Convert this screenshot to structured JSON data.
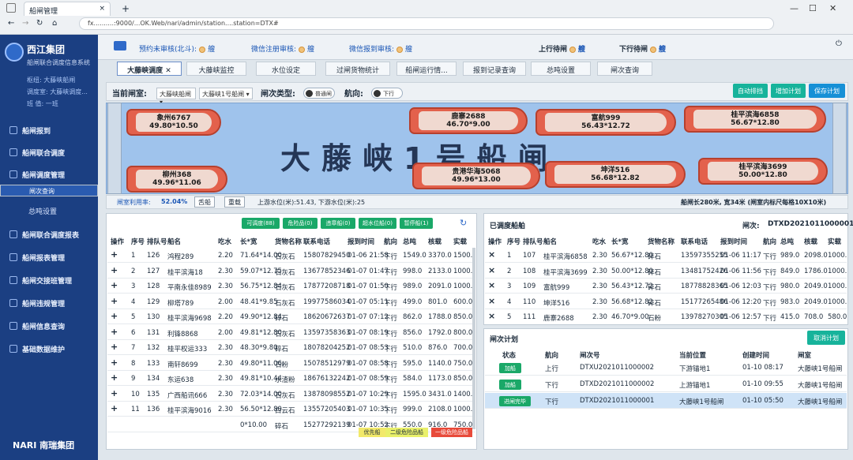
{
  "browser": {
    "tab_title": "船闸管理",
    "address": "fx..........:9000/...OK.Web/nari/admin/station....station=DTX#",
    "new_tab": "+",
    "close_tab": "×"
  },
  "sidebar": {
    "brand": "西江集团",
    "subtitle": "船闸联合调度信息系统",
    "user1": "枢纽: 大藤峡船闸",
    "user2": "调度室: 大藤峡调度...",
    "user3": "班 值: 一班",
    "items": [
      {
        "label": "船闸报到"
      },
      {
        "label": "船闸联合调度"
      },
      {
        "label": "船闸调度管理"
      },
      {
        "label": "闸次查询"
      },
      {
        "label": "总吨设置"
      },
      {
        "label": "船闸联合调度报表"
      },
      {
        "label": "船闸报表管理"
      },
      {
        "label": "船闸交接班管理"
      },
      {
        "label": "船闸违规管理"
      },
      {
        "label": "船闸信息查询"
      },
      {
        "label": "基础数据维护"
      }
    ],
    "footer": "NARI 南瑞集团"
  },
  "statusbar": {
    "s1": "预约未审核(北斗):",
    "v1": "艘",
    "s2": "微信注册审核:",
    "v2": "艘",
    "s3": "微信报到审核:",
    "v3": "艘",
    "s4": "上行待闸",
    "v4": "艘",
    "s5": "下行待闸",
    "v5": "艘"
  },
  "tabs": [
    "大藤峡调度",
    "大藤峡监控",
    "水位设定",
    "过闸货物统计",
    "船闸运行情...",
    "报到记录查询",
    "总吨设置",
    "闸次查询"
  ],
  "toolbar": {
    "lock_label": "当前闸室:",
    "lock_sel1": "大藤峡船闸",
    "lock_sel2": "大藤峡1号船闸",
    "type_label": "闸次类型:",
    "type_val": "普通闸",
    "dir_label": "航向:",
    "dir_val": "下行",
    "btn_auto": "自动排挡",
    "btn_add": "增加计划",
    "btn_save": "保存计划"
  },
  "lock": {
    "title": "大藤峡1号船闸",
    "ships": [
      {
        "name": "象州6767",
        "dim": "49.80*10.50"
      },
      {
        "name": "鹿寨2688",
        "dim": "46.70*9.00"
      },
      {
        "name": "富航999",
        "dim": "56.43*12.72"
      },
      {
        "name": "桂平滨海6858",
        "dim": "56.67*12.80"
      },
      {
        "name": "柳州368",
        "dim": "49.96*11.06"
      },
      {
        "name": "贵港华海5068",
        "dim": "49.96*13.00"
      },
      {
        "name": "坤洋516",
        "dim": "56.68*12.82"
      },
      {
        "name": "桂平滨海3699",
        "dim": "50.00*12.80"
      }
    ]
  },
  "infobar": {
    "util_label": "闸室利用率:",
    "util_val": "52.04%",
    "btn_cut": "舌船",
    "btn_rev": "重载",
    "water": "上游水位(米):51.43,  下游水位(米):25",
    "size": "船闸长280米, 宽34米 (闸室内标尺每格10X10米)"
  },
  "left": {
    "chips": [
      "可调度(88)",
      "危险品(0)",
      "违章船(0)",
      "超水位船(0)",
      "暂停船(1)"
    ],
    "headers": [
      "操作",
      "序号",
      "排队号",
      "船名",
      "吃水",
      "长*宽",
      "货物名称",
      "联系电话",
      "报到时间",
      "航向",
      "总吨",
      "核载",
      "实载"
    ],
    "rows": [
      [
        "+",
        "1",
        "126",
        "鸿程289",
        "2.20",
        "71.64*14.00",
        "石灰石",
        "15807829450",
        "01-06 21:58",
        "下行",
        "1549.0",
        "3370.0",
        "1500.0"
      ],
      [
        "+",
        "2",
        "127",
        "桂平滨海18",
        "2.30",
        "59.07*12.75",
        "石灰石",
        "13677852346",
        "01-07 01:47",
        "下行",
        "998.0",
        "2133.0",
        "1000.0"
      ],
      [
        "+",
        "3",
        "128",
        "平南永佳8989",
        "2.30",
        "56.75*12.84",
        "石灰石",
        "17877208718",
        "01-07 01:50",
        "下行",
        "989.0",
        "2091.0",
        "1000.0"
      ],
      [
        "+",
        "4",
        "129",
        "柳塔789",
        "2.00",
        "48.41*9.85",
        "石灰石",
        "19977586034",
        "01-07 05:11",
        "下行",
        "499.0",
        "801.0",
        "600.0"
      ],
      [
        "+",
        "5",
        "130",
        "桂平滨海9698",
        "2.20",
        "49.90*12.84",
        "碎石",
        "18620672637",
        "01-07 07:12",
        "下行",
        "862.0",
        "1788.0",
        "850.0"
      ],
      [
        "+",
        "6",
        "131",
        "利锋8868",
        "2.00",
        "49.81*12.80",
        "石灰石",
        "13597358363",
        "01-07 08:19",
        "下行",
        "856.0",
        "1792.0",
        "800.0"
      ],
      [
        "+",
        "7",
        "132",
        "桂平权运333",
        "2.30",
        "48.30*9.80",
        "碎石",
        "18078204252",
        "01-07 08:53",
        "下行",
        "510.0",
        "876.0",
        "700.0"
      ],
      [
        "+",
        "8",
        "133",
        "南轩8699",
        "2.30",
        "49.80*11.06",
        "石粉",
        "15078512979",
        "01-07 08:58",
        "下行",
        "595.0",
        "1140.0",
        "750.0"
      ],
      [
        "+",
        "9",
        "134",
        "东运638",
        "2.30",
        "49.81*10.44",
        "水渣粉",
        "18676132242",
        "01-07 08:59",
        "下行",
        "584.0",
        "1173.0",
        "850.0"
      ],
      [
        "+",
        "10",
        "135",
        "广西船讯666",
        "2.30",
        "72.03*14.00",
        "石灰石",
        "13878098552",
        "01-07 10:29",
        "下行",
        "1595.0",
        "3431.0",
        "1400.0"
      ],
      [
        "+",
        "11",
        "136",
        "桂平滨海9016",
        "2.30",
        "56.50*12.80",
        "白云石",
        "13557205403",
        "01-07 10:35",
        "下行",
        "999.0",
        "2108.0",
        "1000.0"
      ],
      [
        "",
        "",
        "",
        "",
        "",
        "0*10.00",
        "碎石",
        "15277292139",
        "01-07 10:52",
        "下行",
        "550.0",
        "916.0",
        "750.0"
      ]
    ],
    "legend": [
      "优先船",
      "二级危险品船",
      "一级危险品船"
    ]
  },
  "right": {
    "title": "已调度船舶",
    "lockno_label": "闸次:",
    "lockno": "DTXD2021011000001",
    "headers": [
      "操作",
      "序号",
      "排队号",
      "船名",
      "吃水",
      "长*宽",
      "货物名称",
      "联系电话",
      "报到时间",
      "航向",
      "总吨",
      "核载",
      "实载"
    ],
    "rows": [
      [
        "×",
        "1",
        "107",
        "桂平滨海6858",
        "2.30",
        "56.67*12.80",
        "碎石",
        "13597355255",
        "01-06 11:17",
        "下行",
        "989.0",
        "2098.0",
        "1000.0"
      ],
      [
        "×",
        "2",
        "108",
        "桂平滨海3699",
        "2.30",
        "50.00*12.80",
        "碎石",
        "13481752426",
        "01-06 11:56",
        "下行",
        "849.0",
        "1786.0",
        "1000.0"
      ],
      [
        "×",
        "3",
        "109",
        "富航999",
        "2.30",
        "56.43*12.72",
        "碎石",
        "18778828365",
        "01-06 12:03",
        "下行",
        "980.0",
        "2049.0",
        "1000.0"
      ],
      [
        "×",
        "4",
        "110",
        "坤洋516",
        "2.30",
        "56.68*12.82",
        "碎石",
        "15177265486",
        "01-06 12:20",
        "下行",
        "983.0",
        "2049.0",
        "1000.0"
      ],
      [
        "×",
        "5",
        "111",
        "鹿寨2688",
        "2.30",
        "46.70*9.00",
        "石粉",
        "13978270305",
        "01-06 12:57",
        "下行",
        "415.0",
        "708.0",
        "580.0"
      ]
    ],
    "plan_title": "闸次计划",
    "plan_cancel": "取消计划",
    "plan_headers": [
      "状态",
      "航向",
      "闸次号",
      "当前位置",
      "创建时间",
      "闸室"
    ],
    "plan_rows": [
      [
        "加船",
        "上行",
        "DTXU2021011000002",
        "下游锚地1",
        "01-10 08:17",
        "大藤峡1号船闸"
      ],
      [
        "加船",
        "下行",
        "DTXD2021011000002",
        "上游锚地1",
        "01-10 09:55",
        "大藤峡1号船闸"
      ],
      [
        "进闸完毕",
        "下行",
        "DTXD2021011000001",
        "大藤峡1号船闸",
        "01-10 05:50",
        "大藤峡1号船闸"
      ]
    ]
  }
}
